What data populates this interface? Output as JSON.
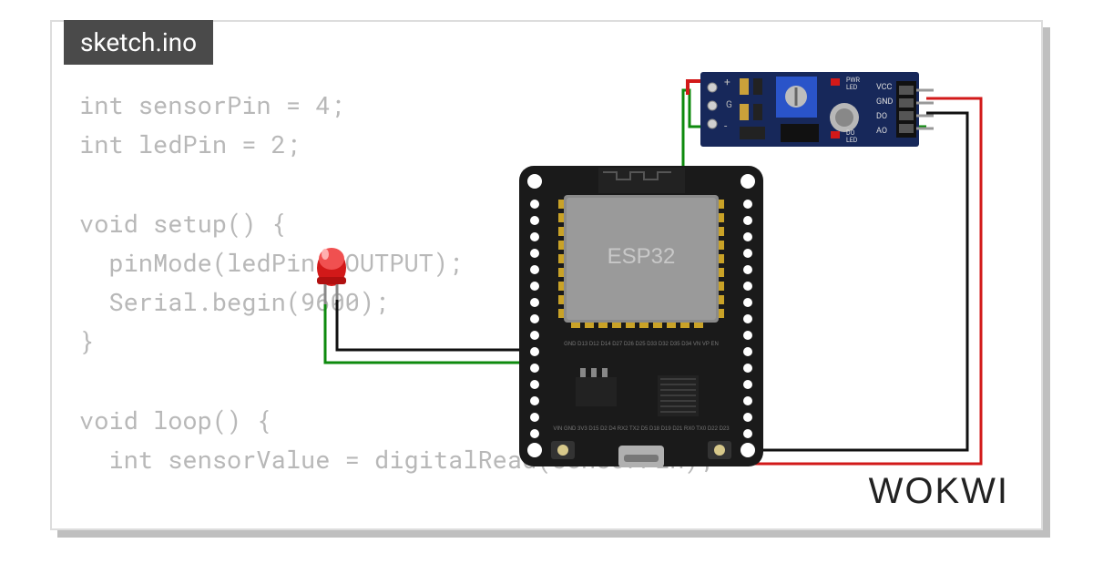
{
  "tab": {
    "filename": "sketch.ino"
  },
  "code": "int sensorPin = 4;\nint ledPin = 2;\n\nvoid setup() {\n  pinMode(ledPin, OUTPUT);\n  Serial.begin(9600);\n}\n\nvoid loop() {\n  int sensorValue = digitalRead(sensorPin);",
  "board": {
    "label": "ESP32"
  },
  "sensor": {
    "pin_labels": {
      "pwr_led": "PWR\nLED",
      "do_led": "DO\nLED",
      "vcc": "VCC",
      "gnd": "GND",
      "do": "DO",
      "ao": "AO"
    }
  },
  "wires": {
    "colors": {
      "green": "#0d8a0d",
      "black": "#111111",
      "red": "#d21919"
    }
  },
  "brand": "WOKWI",
  "components": [
    "esp32-devkit",
    "led-red",
    "sound-sensor-module"
  ]
}
